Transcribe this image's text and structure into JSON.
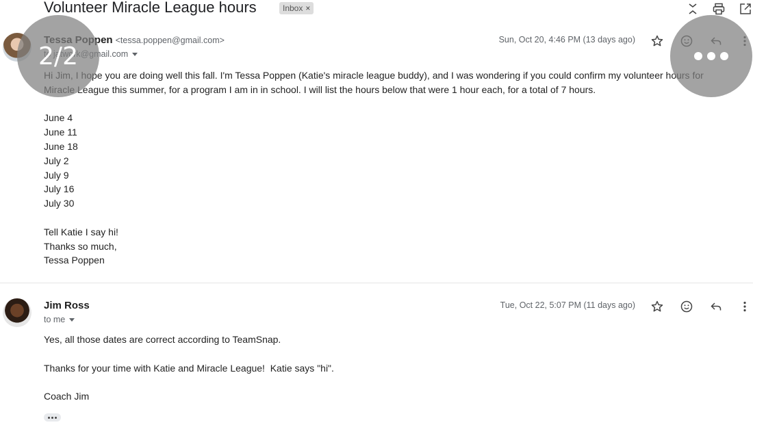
{
  "subject": "Volunteer Miracle League hours",
  "label": {
    "text": "Inbox",
    "remove": "×"
  },
  "toolbar": {
    "icons": [
      "expand-collapse-icon",
      "print-icon",
      "open-in-new-window-icon"
    ]
  },
  "overlays": {
    "counter": "2/2",
    "more_icon": "more-horizontal-icon"
  },
  "messages": [
    {
      "sender_name": "Tessa Poppen",
      "sender_email": "<tessa.poppen@gmail.com>",
      "recipient": "to jatwork@gmail.com",
      "date": "Sun, Oct 20, 4:46 PM (13 days ago)",
      "body": {
        "intro": "Hi Jim, I hope you are doing well this fall. I'm Tessa Poppen (Katie's miracle league buddy), and I was wondering if you could confirm my volunteer hours for Miracle League this summer, for a program I am in in school. I will list the hours below that were 1 hour each, for a total of 7 hours.",
        "dates": [
          "June 4",
          "June 11",
          "June 18",
          "July 2",
          "July 9",
          "July 16",
          "July 30"
        ],
        "closing": [
          "Tell Katie I say hi!",
          "Thanks so much,",
          "Tessa Poppen"
        ]
      }
    },
    {
      "sender_name": "Jim Ross",
      "recipient": "to me",
      "date": "Tue, Oct 22, 5:07 PM (11 days ago)",
      "body": {
        "line1": "Yes, all those dates are correct according to TeamSnap.",
        "line2": "Thanks for your time with Katie and Miracle League!  Katie says \"hi\".",
        "line3": "Coach Jim"
      }
    }
  ],
  "colors": {
    "text": "#202124",
    "muted": "#5f6368",
    "overlay": "#808080"
  }
}
